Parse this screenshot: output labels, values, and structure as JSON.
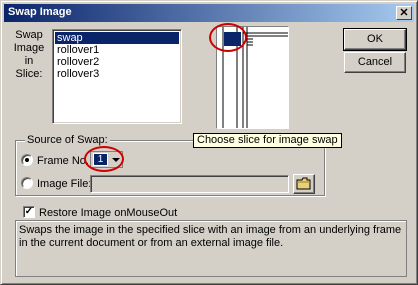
{
  "dialog": {
    "title": "Swap Image",
    "close_glyph": "✕"
  },
  "slice_list": {
    "label_line1": "Swap",
    "label_line2": "Image in",
    "label_line3": "Slice:",
    "items": [
      "swap",
      "rollover1",
      "rollover2",
      "rollover3"
    ],
    "selected": "swap"
  },
  "buttons": {
    "ok": "OK",
    "cancel": "Cancel"
  },
  "tooltip": "Choose slice for image swap",
  "source": {
    "group_title": "Source of Swap:",
    "frame_no_label": "Frame No.:",
    "frame_no_value": "1",
    "image_file_label": "Image File:",
    "image_file_value": "",
    "selected_option": "frame_no"
  },
  "restore": {
    "label": "Restore Image onMouseOut",
    "checked": true
  },
  "description": "Swaps the image in the specified slice with an image from an underlying frame in the current document or from an external image file.",
  "colors": {
    "highlight": "#d00000",
    "selection": "#0a246a",
    "face": "#d4d0c8"
  },
  "icons": [
    "close-icon",
    "dropdown-arrow-icon",
    "folder-icon"
  ]
}
